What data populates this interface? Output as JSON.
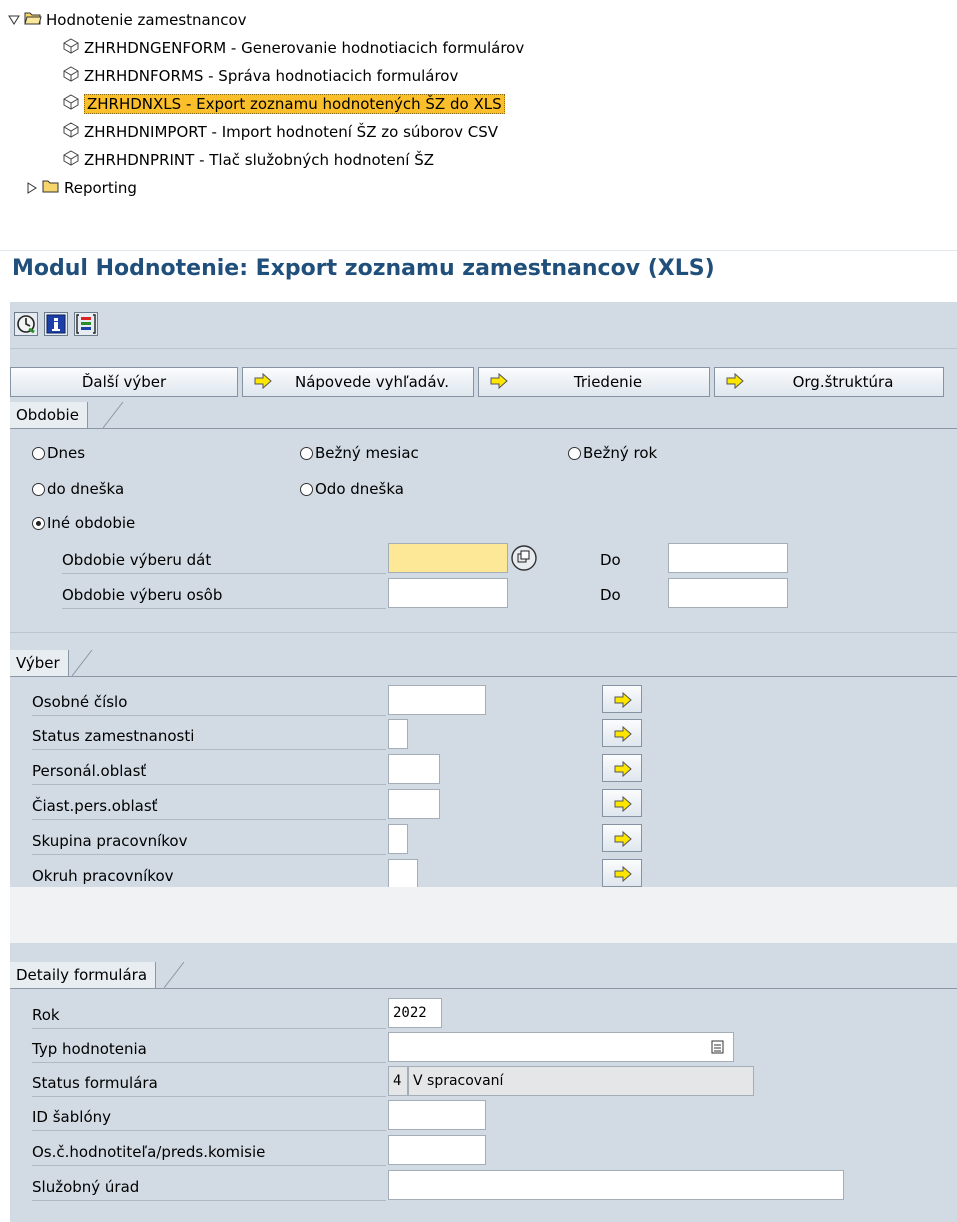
{
  "tree": {
    "parent": "Hodnotenie zamestnancov",
    "items": [
      "ZHRHDNGENFORM - Generovanie hodnotiacich formulárov",
      "ZHRHDNFORMS - Správa hodnotiacich formulárov",
      "ZHRHDNXLS - Export zoznamu hodnotených ŠZ do XLS",
      "ZHRHDNIMPORT - Import hodnotení ŠZ zo súborov CSV",
      "ZHRHDNPRINT - Tlač služobných hodnotení ŠZ"
    ],
    "selected_index": 2,
    "reporting": "Reporting"
  },
  "title": "Modul Hodnotenie: Export zoznamu zamestnancov (XLS)",
  "toolbar": {
    "icons": [
      "execute-icon",
      "info-icon",
      "selection-options-icon"
    ]
  },
  "push_buttons": [
    "Ďalší výber",
    "Nápovede vyhľadáv.",
    "Triedenie",
    "Org.štruktúra"
  ],
  "obdobie": {
    "title": "Obdobie",
    "radios": [
      "Dnes",
      "Bežný mesiac",
      "Bežný rok",
      "do dneška",
      "Odo dneška",
      "Iné obdobie"
    ],
    "selected": "Iné obdobie",
    "fields": [
      {
        "label": "Obdobie výberu dát",
        "value": "",
        "to_label": "Do",
        "to_value": ""
      },
      {
        "label": "Obdobie výberu osôb",
        "value": "",
        "to_label": "Do",
        "to_value": ""
      }
    ]
  },
  "vyber": {
    "title": "Výber",
    "fields": [
      "Osobné číslo",
      "Status zamestnanosti",
      "Personál.oblasť",
      "Čiast.pers.oblasť",
      "Skupina pracovníkov",
      "Okruh pracovníkov"
    ]
  },
  "detaily": {
    "title": "Detaily formulára",
    "rok_label": "Rok",
    "rok_value": "2022",
    "typ_label": "Typ hodnotenia",
    "typ_value": "",
    "status_label": "Status formulára",
    "status_code": "4",
    "status_text": "V spracovaní",
    "sablona_label": "ID šablóny",
    "hodnotitel_label": "Os.č.hodnotiteľa/preds.komisie",
    "urad_label": "Služobný úrad"
  },
  "colors": {
    "panel": "#d2dbe4",
    "title": "#1f4f7a",
    "selected": "#fbbf2b",
    "required": "#fce896"
  }
}
